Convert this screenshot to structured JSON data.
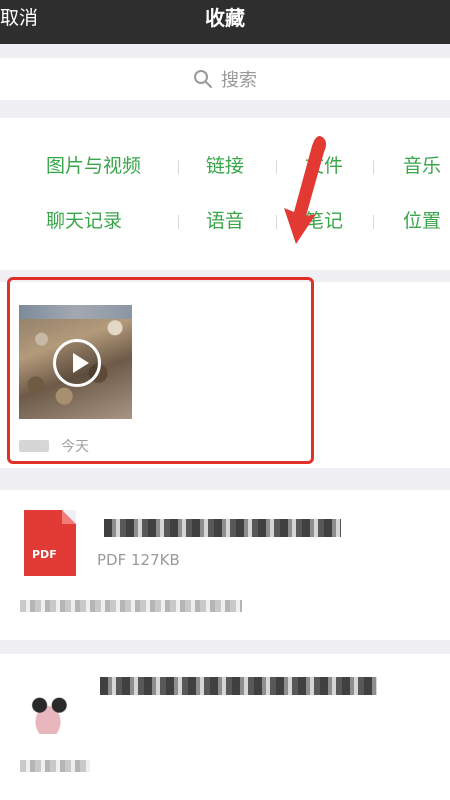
{
  "header": {
    "cancel_label": "取消",
    "title": "收藏"
  },
  "search": {
    "placeholder": "搜索",
    "icon": "search-icon"
  },
  "categories": {
    "row1": [
      "图片与视频",
      "链接",
      "文件",
      "音乐"
    ],
    "row2": [
      "聊天记录",
      "语音",
      "笔记",
      "位置"
    ],
    "color": "#3aa64a"
  },
  "items": [
    {
      "type": "video",
      "date": "今天",
      "icon": "play-icon"
    },
    {
      "type": "file",
      "file_badge": "PDF",
      "info": "PDF 127KB"
    },
    {
      "type": "chat"
    }
  ],
  "colors": {
    "header_bg": "#2e2e2e",
    "highlight": "#e0302a",
    "accent_green": "#3aa64a"
  }
}
